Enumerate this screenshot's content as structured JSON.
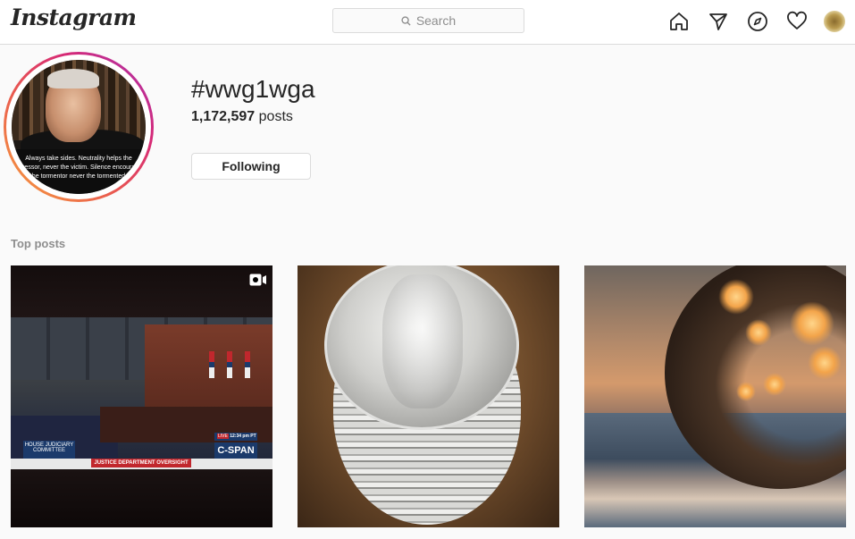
{
  "nav": {
    "logo": "Instagram",
    "search_placeholder": "Search",
    "icons": [
      "home-icon",
      "direct-message-icon",
      "explore-compass-icon",
      "activity-heart-icon",
      "profile-avatar"
    ]
  },
  "profile": {
    "hashtag": "#wwg1wga",
    "posts_count": "1,172,597",
    "posts_label": "posts",
    "follow_button": "Following",
    "photo_caption": "Always take sides. Neutrality helps the oppressor, never the victim. Silence encourages the tormentor never the tormented."
  },
  "top_posts": {
    "label": "Top posts",
    "posts": [
      {
        "type": "video",
        "left_logo": "HOUSE JUDICIARY COMMITTEE",
        "banner": "JUSTICE DEPARTMENT OVERSIGHT",
        "live_tag": "LIVE",
        "time": "12:34 pm PT",
        "network": "C-SPAN"
      },
      {
        "type": "image"
      },
      {
        "type": "image"
      }
    ]
  },
  "colors": {
    "accent_ring_start": "#f7a23c",
    "accent_ring_end": "#a633b3",
    "border": "#dbdbdb",
    "muted_text": "#8e8e8e"
  }
}
